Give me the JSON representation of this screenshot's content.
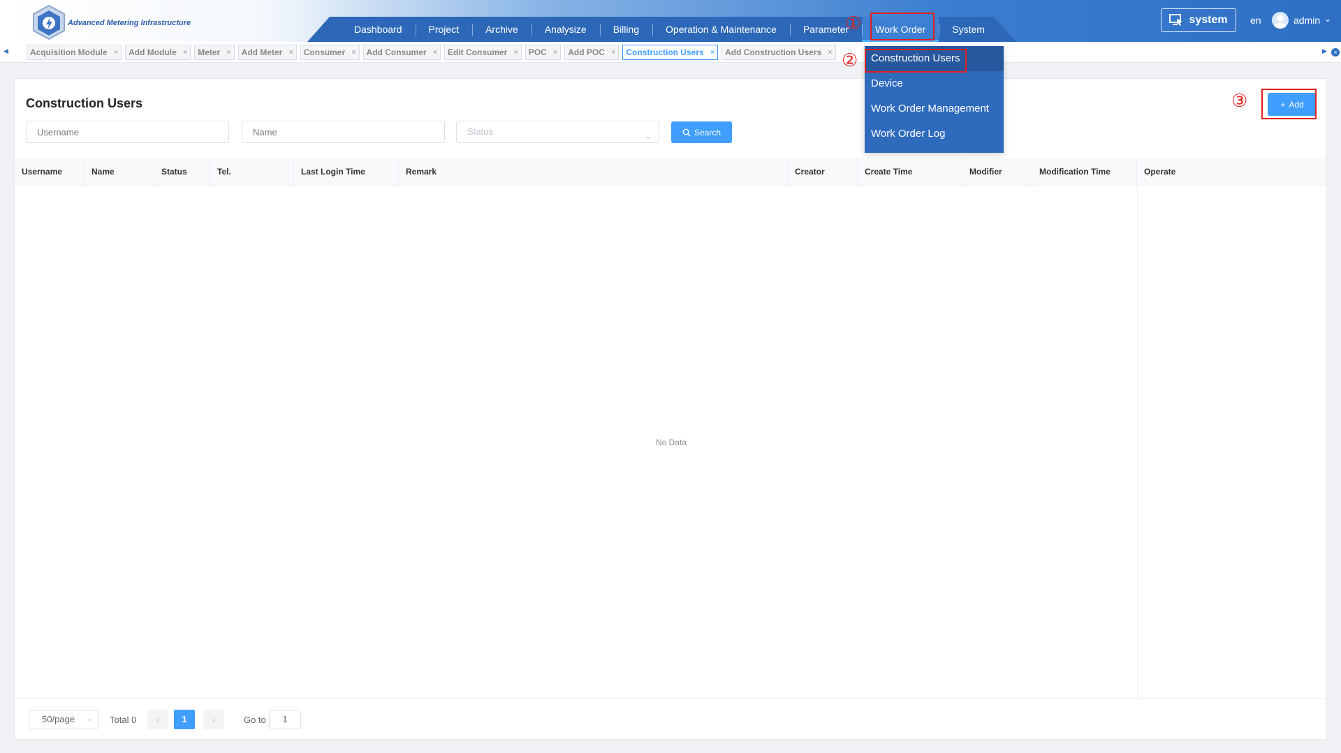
{
  "header": {
    "logo_text": "Advanced Metering Infrastructure",
    "nav": [
      {
        "label": "Dashboard"
      },
      {
        "label": "Project"
      },
      {
        "label": "Archive"
      },
      {
        "label": "Analysize"
      },
      {
        "label": "Billing"
      },
      {
        "label": "Operation & Maintenance"
      },
      {
        "label": "Parameter"
      },
      {
        "label": "Work Order"
      },
      {
        "label": "System"
      }
    ],
    "active_nav": "Work Order",
    "system_label": "system",
    "lang": "en",
    "user": "admin"
  },
  "tags": [
    {
      "label": "Acquisition Module"
    },
    {
      "label": "Add Module"
    },
    {
      "label": "Meter"
    },
    {
      "label": "Add Meter"
    },
    {
      "label": "Consumer"
    },
    {
      "label": "Add Consumer"
    },
    {
      "label": "Edit Consumer"
    },
    {
      "label": "POC"
    },
    {
      "label": "Add POC"
    },
    {
      "label": "Construction Users"
    },
    {
      "label": "Add Construction Users"
    }
  ],
  "active_tag": "Construction Users",
  "dropdown": {
    "items": [
      {
        "label": "Construction Users"
      },
      {
        "label": "Device"
      },
      {
        "label": "Work Order Management"
      },
      {
        "label": "Work Order Log"
      }
    ],
    "active": "Construction Users"
  },
  "page": {
    "title": "Construction Users",
    "filters": {
      "username_placeholder": "Username",
      "name_placeholder": "Name",
      "status_placeholder": "Status"
    },
    "search_label": "Search",
    "add_label": "Add"
  },
  "table": {
    "columns": [
      "Username",
      "Name",
      "Status",
      "Tel.",
      "Last Login Time",
      "Remark",
      "Creator",
      "Create Time",
      "Modifier",
      "Modification Time",
      "Operate"
    ],
    "rows": [],
    "empty_text": "No Data"
  },
  "pagination": {
    "page_size": "50/page",
    "total": "Total 0",
    "current_page": "1",
    "goto_label": "Go to",
    "goto_value": "1"
  },
  "annotations": [
    "①",
    "②",
    "③"
  ],
  "colors": {
    "accent": "#409eff",
    "nav": "#2d68b8",
    "marker": "#e02020"
  }
}
